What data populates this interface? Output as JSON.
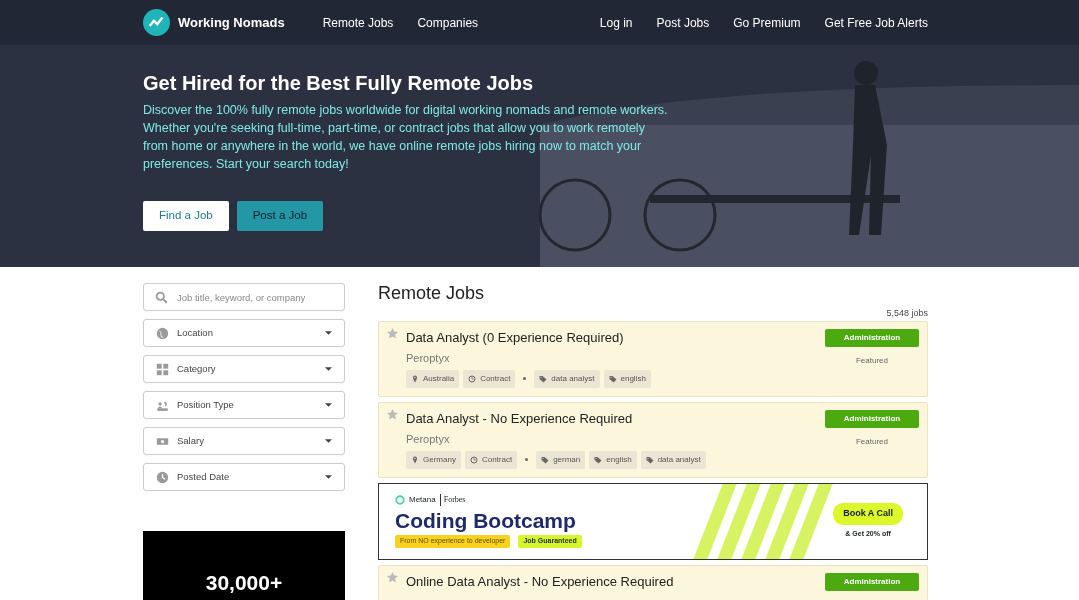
{
  "navbar": {
    "brand": "Working Nomads",
    "left_links": [
      "Remote Jobs",
      "Companies"
    ],
    "right_links": [
      "Log in",
      "Post Jobs",
      "Go Premium",
      "Get Free Job Alerts"
    ]
  },
  "hero": {
    "title": "Get Hired for the Best Fully Remote Jobs",
    "text": "Discover the 100% fully remote jobs worldwide for digital working nomads and remote workers. Whether you're seeking full-time, part-time, or contract jobs that allow you to work remotely from home or anywhere in the world, we have online remote jobs hiring now to match your preferences. Start your search today!",
    "buttons": [
      {
        "label": "Find a Job",
        "kind": "light"
      },
      {
        "label": "Post a Job",
        "kind": "teal"
      }
    ]
  },
  "sidebar": {
    "search": {
      "placeholder": "Job title, keyword, or company"
    },
    "filters": [
      {
        "label": "Location"
      },
      {
        "label": "Category"
      },
      {
        "label": "Position Type"
      },
      {
        "label": "Salary"
      },
      {
        "label": "Posted Date"
      }
    ],
    "ad": {
      "headline": "30,000+"
    }
  },
  "main": {
    "heading": "Remote Jobs",
    "count": "5,548 jobs",
    "items": [
      {
        "kind": "job",
        "title": "Data Analyst (0 Experience Required)",
        "company": "Peroptyx",
        "category": "Administration",
        "badge": "Featured",
        "tags": [
          {
            "kind": "location",
            "text": "Australia"
          },
          {
            "kind": "type",
            "text": "Contract"
          },
          {
            "kind": "tag",
            "text": "data analyst"
          },
          {
            "kind": "tag",
            "text": "english"
          }
        ]
      },
      {
        "kind": "job",
        "title": "Data Analyst - No Experience Required",
        "company": "Peroptyx",
        "category": "Administration",
        "badge": "Featured",
        "tags": [
          {
            "kind": "location",
            "text": "Germany"
          },
          {
            "kind": "type",
            "text": "Contract"
          },
          {
            "kind": "tag",
            "text": "german"
          },
          {
            "kind": "tag",
            "text": "english"
          },
          {
            "kind": "tag",
            "text": "data analyst"
          }
        ]
      },
      {
        "kind": "ad",
        "brand": "Metana",
        "partner": "Forbes",
        "headline": "Coding Bootcamp",
        "badges": [
          "From NO experience to developer",
          "Job Guaranteed"
        ],
        "cta": "Book A Call",
        "cta_note": "& Get 20% off"
      },
      {
        "kind": "job",
        "title": "Online Data Analyst - No Experience Required",
        "category": "Administration"
      }
    ]
  }
}
